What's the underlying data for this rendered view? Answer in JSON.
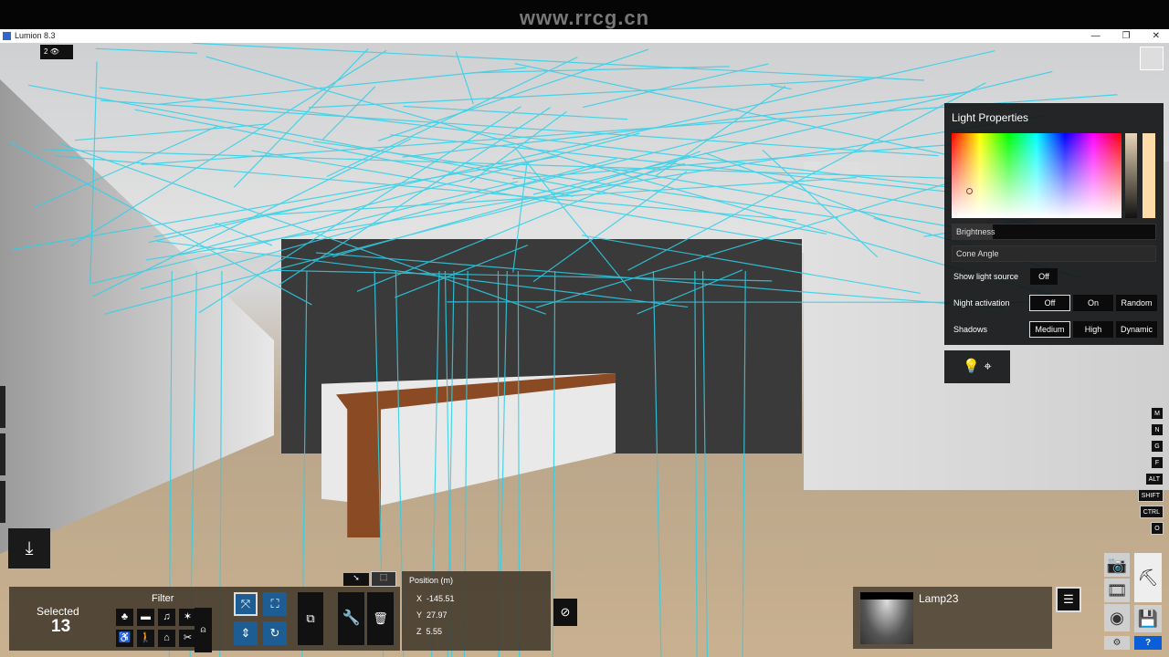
{
  "watermark": "www.rrcg.cn",
  "window": {
    "title": "Lumion 8.3",
    "minimize": "—",
    "maximize": "❐",
    "close": "✕"
  },
  "viewport": {
    "camera_index": "2",
    "eye_icon": "👁"
  },
  "light_properties": {
    "title": "Light Properties",
    "brightness_label": "Brightness",
    "brightness_value": 0.2,
    "cone_angle_label": "Cone Angle",
    "cone_angle_value": 0.97,
    "swatch_color": "#fedcaa",
    "show_light_source": {
      "label": "Show light source",
      "value": "Off"
    },
    "night_activation": {
      "label": "Night activation",
      "options": [
        "Off",
        "On",
        "Random"
      ],
      "selected": "Off"
    },
    "shadows": {
      "label": "Shadows",
      "options": [
        "Medium",
        "High",
        "Dynamic"
      ],
      "selected": "Medium"
    }
  },
  "shortcut_keys": [
    "M",
    "N",
    "G",
    "F",
    "ALT",
    "SHIFT",
    "CTRL",
    "O"
  ],
  "selection": {
    "label": "Selected",
    "count": "13",
    "filter_label": "Filter"
  },
  "filter_icons": [
    "tree-icon",
    "car-icon",
    "music-icon",
    "effects-icon",
    "chair-icon",
    "person-icon",
    "house-icon",
    "tools-icon"
  ],
  "position": {
    "title": "Position (m)",
    "x_label": "X",
    "x": "-145.51",
    "y_label": "Y",
    "y": "27.97",
    "z_label": "Z",
    "z": "5.55"
  },
  "object": {
    "name": "Lamp23"
  },
  "help": "?"
}
